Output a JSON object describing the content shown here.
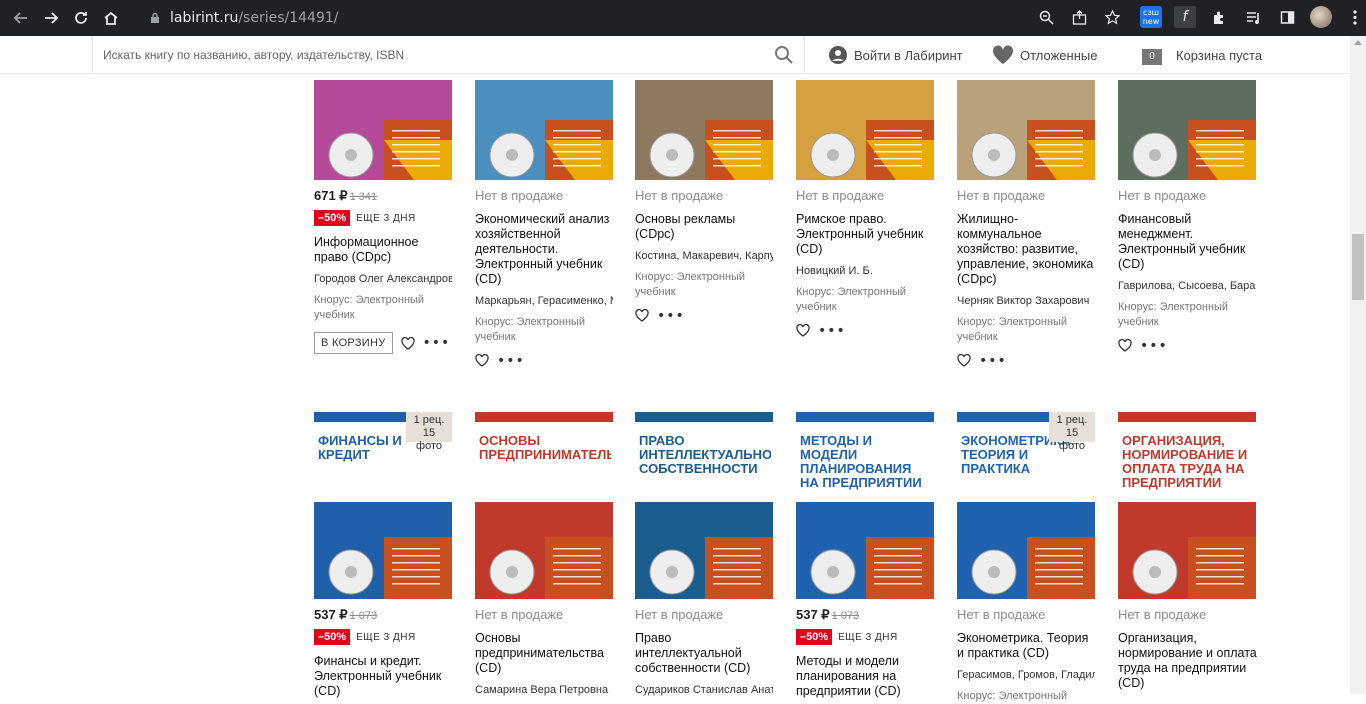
{
  "browser": {
    "url_host": "labirint.ru",
    "url_path": "/series/14491/",
    "ext_new_top": "сзш",
    "ext_new_label": "new",
    "ext_f": "f"
  },
  "header": {
    "search_placeholder": "Искать книгу по названию, автору, издательству, ISBN",
    "login": "Войти в Лабиринт",
    "postponed": "Отложенные",
    "cart_count": "0",
    "cart": "Корзина пуста"
  },
  "labels": {
    "not_available": "Нет в продаже",
    "to_cart": "В КОРЗИНУ",
    "more": "•••"
  },
  "row1": [
    {
      "available": true,
      "price": "671 ₽",
      "old_price": "1 341",
      "discount": "–50%",
      "till": "ЕЩЕ 3 ДНЯ",
      "title": "Информационное право (CDpc)",
      "author": "Городов Олег Александрович",
      "publisher": "Кнорус: Электронный учебник",
      "cover_color": "#b64a9a"
    },
    {
      "available": false,
      "title": "Экономический анализ хозяйственной деятельности. Электронный учебник (CD)",
      "author": "Маркарьян, Герасименко, Маркарьян",
      "publisher": "Кнорус: Электронный учебник",
      "cover_color": "#4a8fbf"
    },
    {
      "available": false,
      "title": "Основы рекламы (CDpc)",
      "author": "Костина, Макаревич, Карпухин",
      "publisher": "Кнорус: Электронный учебник",
      "cover_color": "#8d7a5e"
    },
    {
      "available": false,
      "title": "Римское право. Электронный учебник (CD)",
      "author": "Новицкий И. Б.",
      "publisher": "Кнорус: Электронный учебник",
      "cover_color": "#d4a040"
    },
    {
      "available": false,
      "title": "Жилищно-коммунальное хозяйство: развитие, управление, экономика (CDpc)",
      "author": "Черняк Виктор Захарович",
      "publisher": "Кнорус: Электронный учебник",
      "cover_color": "#b9a27a"
    },
    {
      "available": false,
      "title": "Финансовый менеджмент. Электронный учебник (CD)",
      "author": "Гаврилова, Сысоева, Барабанов",
      "publisher": "Кнорус: Электронный учебник",
      "cover_color": "#5e6e5e"
    }
  ],
  "row2": [
    {
      "available": true,
      "rec": "1 рец.",
      "photos": "15 фото",
      "price": "537 ₽",
      "old_price": "1 073",
      "discount": "–50%",
      "till": "ЕЩЕ 3 ДНЯ",
      "title": "Финансы и кредит. Электронный учебник (CD)",
      "cover_title": "ФИНАНСЫ И КРЕДИТ",
      "cover_color": "#1f5ea8"
    },
    {
      "available": false,
      "title": "Основы предпринимательства (CD)",
      "author": "Самарина Вера Петровна",
      "cover_title": "ОСНОВЫ ПРЕДПРИНИМАТЕЛЬСТВА",
      "cover_color": "#c0392b"
    },
    {
      "available": false,
      "title": "Право интеллектуальной собственности (CD)",
      "author": "Судариков Станислав Анатольевич",
      "cover_title": "ПРАВО ИНТЕЛЛЕКТУАЛЬНОЙ СОБСТВЕННОСТИ",
      "cover_color": "#1a5e8f"
    },
    {
      "available": true,
      "price": "537 ₽",
      "old_price": "1 073",
      "discount": "–50%",
      "till": "ЕЩЕ 3 ДНЯ",
      "title": "Методы и модели планирования на предприятии (CD)",
      "cover_title": "МЕТОДЫ И МОДЕЛИ ПЛАНИРОВАНИЯ НА ПРЕДПРИЯТИИ",
      "cover_color": "#1f63b0"
    },
    {
      "available": false,
      "rec": "1 рец.",
      "photos": "15 фото",
      "title": "Эконометрика. Теория и практика (CD)",
      "author": "Герасимов, Громов, Гладилин",
      "publisher": "Кнорус: Электронный",
      "cover_title": "ЭКОНОМЕТРИКА: ТЕОРИЯ И ПРАКТИКА",
      "cover_color": "#1f63b0"
    },
    {
      "available": false,
      "title": "Организация, нормирование и оплата труда на предприятии (CD)",
      "cover_title": "ОРГАНИЗАЦИЯ, НОРМИРОВАНИЕ И ОПЛАТА ТРУДА НА ПРЕДПРИЯТИИ",
      "cover_color": "#c0392b"
    }
  ],
  "colors": {
    "chrome_bg": "#202124",
    "badge_red": "#e3001b",
    "cover_orange": "#c8501e",
    "cover_yellow": "#f2c200"
  }
}
